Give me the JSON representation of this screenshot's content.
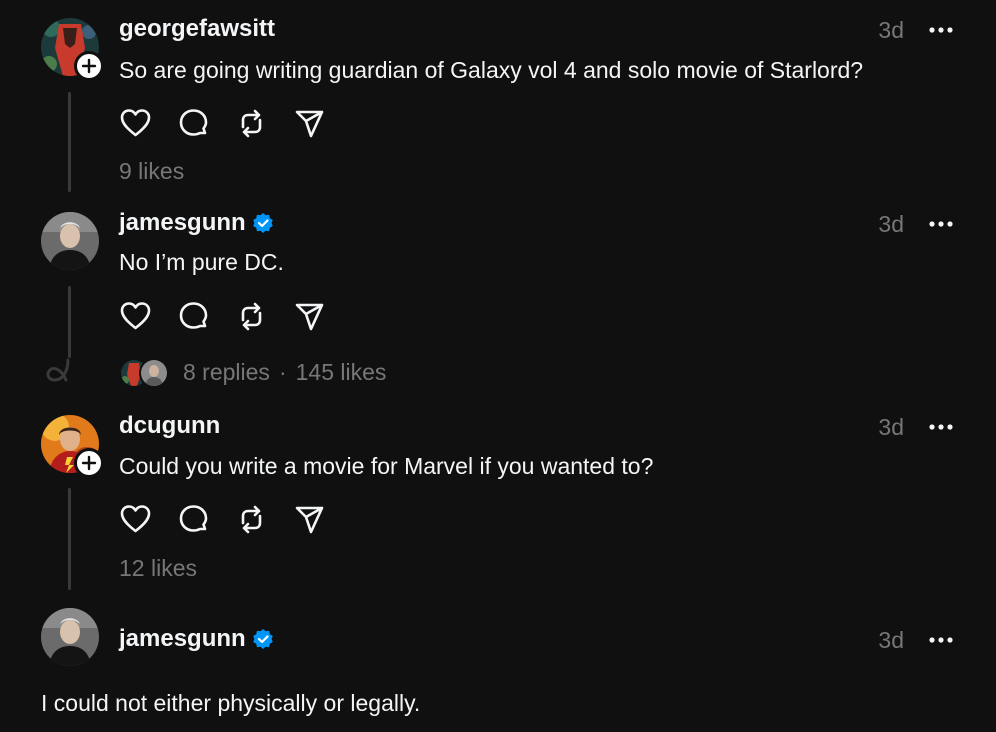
{
  "colors": {
    "background": "#101010",
    "text_primary": "#f3f5f7",
    "text_secondary": "#777777",
    "verified_blue": "#0095f6",
    "thread_line": "#3a3a3a"
  },
  "posts": [
    {
      "username": "georgefawsitt",
      "verified": false,
      "follow_badge": true,
      "time": "3d",
      "text": "So are going writing guardian of Galaxy vol 4 and solo movie of Starlord?",
      "stats": "9 likes",
      "icons": [
        "heart-icon",
        "comment-icon",
        "repost-icon",
        "share-icon"
      ]
    },
    {
      "username": "jamesgunn",
      "verified": true,
      "follow_badge": false,
      "time": "3d",
      "text": "No I’m pure DC.",
      "replies": "8 replies",
      "separator": "·",
      "likes": "145 likes",
      "icons": [
        "heart-icon",
        "comment-icon",
        "repost-icon",
        "share-icon"
      ]
    },
    {
      "username": "dcugunn",
      "verified": false,
      "follow_badge": true,
      "time": "3d",
      "text": "Could you write a movie for Marvel if you wanted to?",
      "stats": "12 likes",
      "icons": [
        "heart-icon",
        "comment-icon",
        "repost-icon",
        "share-icon"
      ]
    },
    {
      "username": "jamesgunn",
      "verified": true,
      "follow_badge": false,
      "time": "3d",
      "text": "I could not either physically or legally."
    }
  ]
}
